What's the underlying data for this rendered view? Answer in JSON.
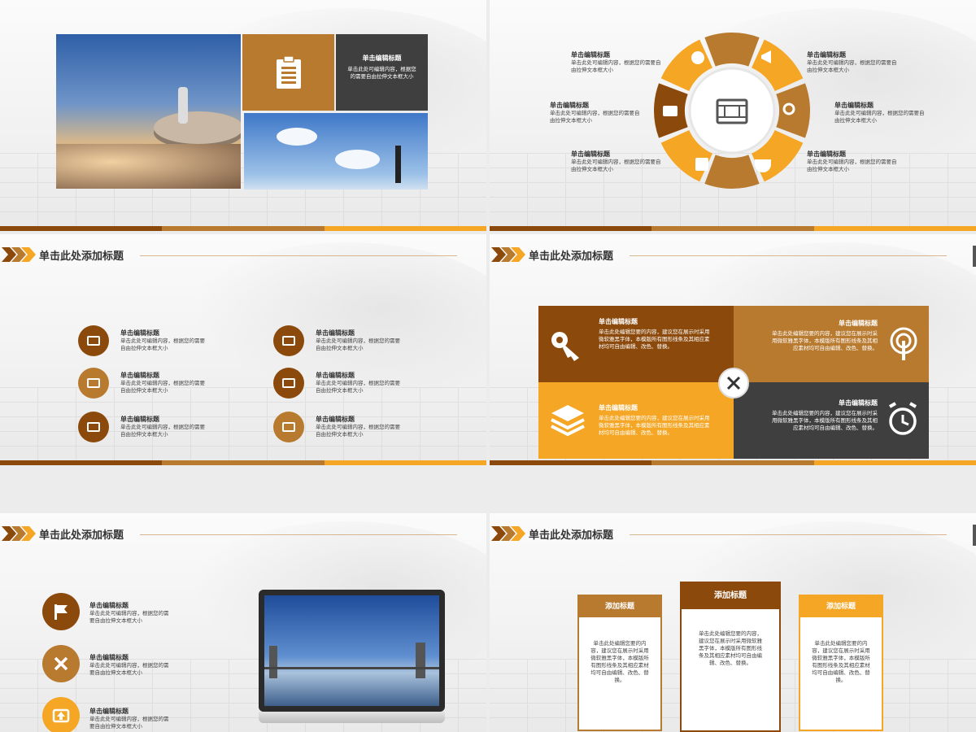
{
  "colors": {
    "dark": "#8b4a0b",
    "mid": "#b87a2f",
    "gold": "#f4a624",
    "charcoal": "#3f3f3f"
  },
  "slide1": {
    "box_title": "单击编辑标题",
    "box_text": "单击此处可编辑内容，根据您的需要自由拉伸文本框大小",
    "icon_clipboard": "clipboard-icon"
  },
  "slide2": {
    "labels": [
      {
        "title": "单击编辑标题",
        "text": "单击此处可编辑内容，根据您的需要自由拉伸文本框大小"
      },
      {
        "title": "单击编辑标题",
        "text": "单击此处可编辑内容，根据您的需要自由拉伸文本框大小"
      },
      {
        "title": "单击编辑标题",
        "text": "单击此处可编辑内容，根据您的需要自由拉伸文本框大小"
      },
      {
        "title": "单击编辑标题",
        "text": "单击此处可编辑内容，根据您的需要自由拉伸文本框大小"
      },
      {
        "title": "单击编辑标题",
        "text": "单击此处可编辑内容，根据您的需要自由拉伸文本框大小"
      },
      {
        "title": "单击编辑标题",
        "text": "单击此处可编辑内容，根据您的需要自由拉伸文本框大小"
      }
    ]
  },
  "slide3": {
    "header": "单击此处添加标题",
    "items": [
      {
        "title": "单击编辑标题",
        "text1": "单击此处可编辑内容，根据您的需要",
        "text2": "自由拉伸文本框大小"
      },
      {
        "title": "单击编辑标题",
        "text1": "单击此处可编辑内容，根据您的需要",
        "text2": "自由拉伸文本框大小"
      },
      {
        "title": "单击编辑标题",
        "text1": "单击此处可编辑内容，根据您的需要",
        "text2": "自由拉伸文本框大小"
      },
      {
        "title": "单击编辑标题",
        "text1": "单击此处可编辑内容，根据您的需要",
        "text2": "自由拉伸文本框大小"
      },
      {
        "title": "单击编辑标题",
        "text1": "单击此处可编辑内容，根据您的需要",
        "text2": "自由拉伸文本框大小"
      },
      {
        "title": "单击编辑标题",
        "text1": "单击此处可编辑内容，根据您的需要",
        "text2": "自由拉伸文本框大小"
      }
    ]
  },
  "slide4": {
    "header": "单击此处添加标题",
    "panels": [
      {
        "title": "单击编辑标题",
        "text": "单击此处编辑您要的内容，建议您在展示时采用微软雅黑字体，本模版所有图形线条及其相应素材均可自由编辑、改色、替换。"
      },
      {
        "title": "单击编辑标题",
        "text": "单击此处编辑您要的内容，建议您在展示时采用微软雅黑字体，本模版所有图形线条及其相应素材均可自由编辑、改色、替换。"
      },
      {
        "title": "单击编辑标题",
        "text": "单击此处编辑您要的内容，建议您在展示时采用微软雅黑字体，本模版所有图形线条及其相应素材均可自由编辑、改色、替换。"
      },
      {
        "title": "单击编辑标题",
        "text": "单击此处编辑您要的内容，建议您在展示时采用微软雅黑字体，本模版所有图形线条及其相应素材均可自由编辑、改色、替换。"
      }
    ]
  },
  "slide5": {
    "header": "单击此处添加标题",
    "items": [
      {
        "title": "单击编辑标题",
        "text1": "单击此处可编辑内容，根据您的需",
        "text2": "要自由拉伸文本框大小"
      },
      {
        "title": "单击编辑标题",
        "text1": "单击此处可编辑内容，根据您的需",
        "text2": "要自由拉伸文本框大小"
      },
      {
        "title": "单击编辑标题",
        "text1": "单击此处可编辑内容，根据您的需",
        "text2": "要自由拉伸文本框大小"
      }
    ]
  },
  "slide6": {
    "header": "单击此处添加标题",
    "cards": [
      {
        "title": "添加标题",
        "text": "单击此处编辑您要的内容，建议您在展示时采用微软雅黑字体，本模版所有图形线条及其相应素材均可自由编辑、改色、替换。"
      },
      {
        "title": "添加标题",
        "text": "单击此处编辑您要的内容，建议您在展示时采用微软雅黑字体，本模版所有图形线条及其相应素材均可自由编辑、改色、替换。"
      },
      {
        "title": "添加标题",
        "text": "单击此处编辑您要的内容，建议您在展示时采用微软雅黑字体，本模版所有图形线条及其相应素材均可自由编辑、改色、替换。"
      }
    ]
  }
}
